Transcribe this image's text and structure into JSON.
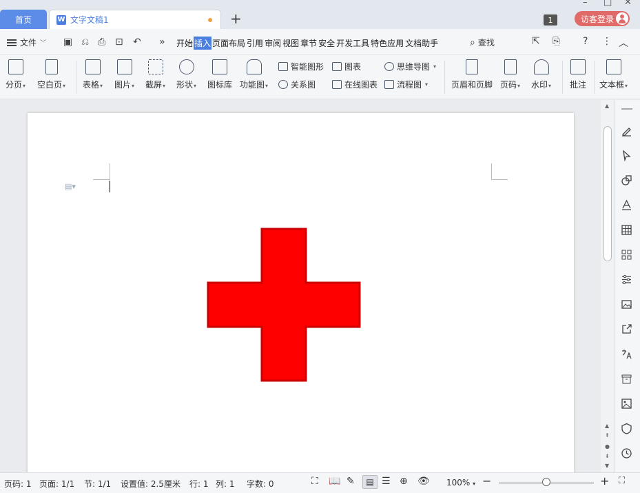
{
  "tabs": {
    "home": "首页",
    "document": "文字文稿1",
    "doc_icon": "W"
  },
  "titlebar": {
    "window_count": "1",
    "login_label": "访客登录"
  },
  "menu": {
    "file_label": "文件",
    "tabs": [
      "开始",
      "插入",
      "页面布局",
      "引用",
      "审阅",
      "视图",
      "章节",
      "安全",
      "开发工具",
      "特色应用",
      "文档助手"
    ],
    "active_tab": "插入",
    "search_label": "查找"
  },
  "ribbon": {
    "page_break": "分页",
    "blank_page": "空白页",
    "table": "表格",
    "picture": "图片",
    "screenshot": "截屏",
    "shape": "形状",
    "icon_library": "图标库",
    "function_chart": "功能图",
    "smart_graphic": "智能图形",
    "chart": "图表",
    "mind_map": "思维导图",
    "relation_chart": "关系图",
    "online_chart": "在线图表",
    "flow_chart": "流程图",
    "header_footer": "页眉和页脚",
    "page_number": "页码",
    "watermark": "水印",
    "comment": "批注",
    "text_box": "文本框"
  },
  "shape": {
    "color": "#ff0000",
    "stroke": "#cc0000"
  },
  "status": {
    "page_num": "页码: 1",
    "pages": "页面: 1/1",
    "section": "节: 1/1",
    "setting": "设置值: 2.5厘米",
    "row": "行: 1",
    "col": "列: 1",
    "word_count": "字数: 0",
    "zoom": "100%"
  },
  "colors": {
    "accent": "#4a7ee0",
    "home_tab": "#5b8ce8",
    "login": "#e06a68"
  }
}
